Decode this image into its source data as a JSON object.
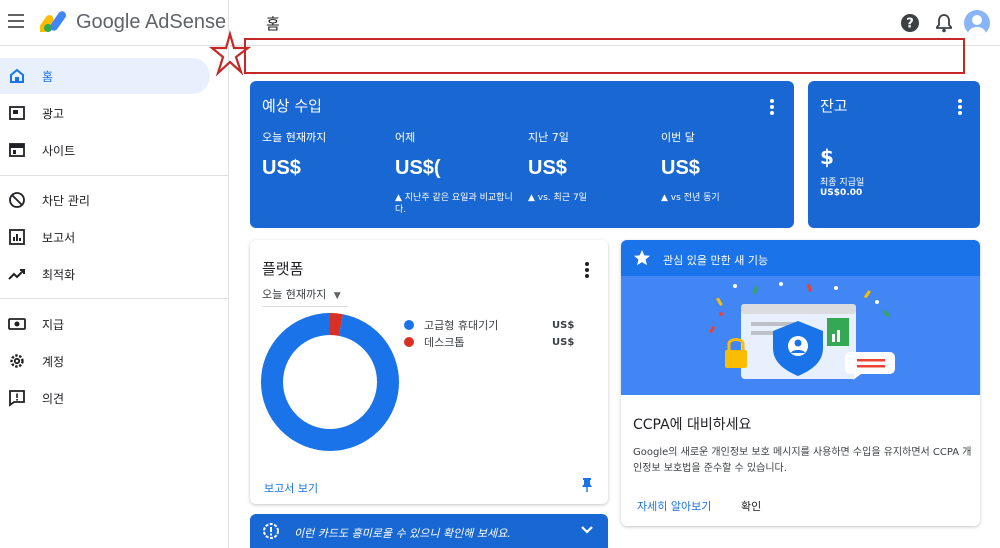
{
  "header": {
    "app_name": "Google AdSense",
    "page_title": "홈",
    "icons": [
      "menu-icon",
      "adsense-logo",
      "help-icon",
      "bell-icon",
      "avatar"
    ]
  },
  "sidebar": {
    "items": [
      {
        "label": "홈",
        "icon": "home-icon",
        "active": true
      },
      {
        "label": "광고",
        "icon": "ads-icon"
      },
      {
        "label": "사이트",
        "icon": "sites-icon"
      },
      {
        "label": "차단 관리",
        "icon": "block-icon"
      },
      {
        "label": "보고서",
        "icon": "reports-icon"
      },
      {
        "label": "최적화",
        "icon": "optimize-icon"
      },
      {
        "label": "지급",
        "icon": "payments-icon"
      },
      {
        "label": "계정",
        "icon": "gear-icon"
      },
      {
        "label": "의견",
        "icon": "feedback-icon"
      }
    ]
  },
  "earnings": {
    "title": "예상 수입",
    "columns": [
      {
        "label": "오늘 현재까지",
        "value": "US$",
        "sub": ""
      },
      {
        "label": "어제",
        "value": "US$(",
        "sub": "▲ 지난주 같은 요일과 비교합니다."
      },
      {
        "label": "지난 7일",
        "value": "US$",
        "sub": "▲ vs. 최근 7일"
      },
      {
        "label": "이번 달",
        "value": "US$",
        "sub": "▲ vs 전년 동기"
      }
    ]
  },
  "balance": {
    "title": "잔고",
    "value": "$",
    "last_payment_label": "최종 지급일",
    "last_payment_amount": "US$0.00"
  },
  "platform": {
    "title": "플랫폼",
    "filter": "오늘 현재까지",
    "legend": [
      {
        "label": "고급형 휴대기기",
        "value": "US$",
        "color": "#1a73e8"
      },
      {
        "label": "데스크톱",
        "value": "US$",
        "color": "#d93025"
      }
    ],
    "donut_share": {
      "mobile": 0.97,
      "desktop": 0.03
    },
    "link": "보고서 보기"
  },
  "feature": {
    "header": "관심 있을 만한 새 기능",
    "title": "CCPA에 대비하세요",
    "body": "Google의 새로운 개인정보 보호 메시지를 사용하면 수입을 유지하면서 CCPA 개인정보 보호법을 준수할 수 있습니다.",
    "link": "자세히 알아보기",
    "confirm": "확인"
  },
  "banner": {
    "text": "이런 카드도 흥미로울 수 있으니 확인해 보세요."
  },
  "colors": {
    "primary": "#1967d2",
    "accent": "#1a73e8",
    "desktop": "#d93025",
    "annotation": "#c62828"
  }
}
